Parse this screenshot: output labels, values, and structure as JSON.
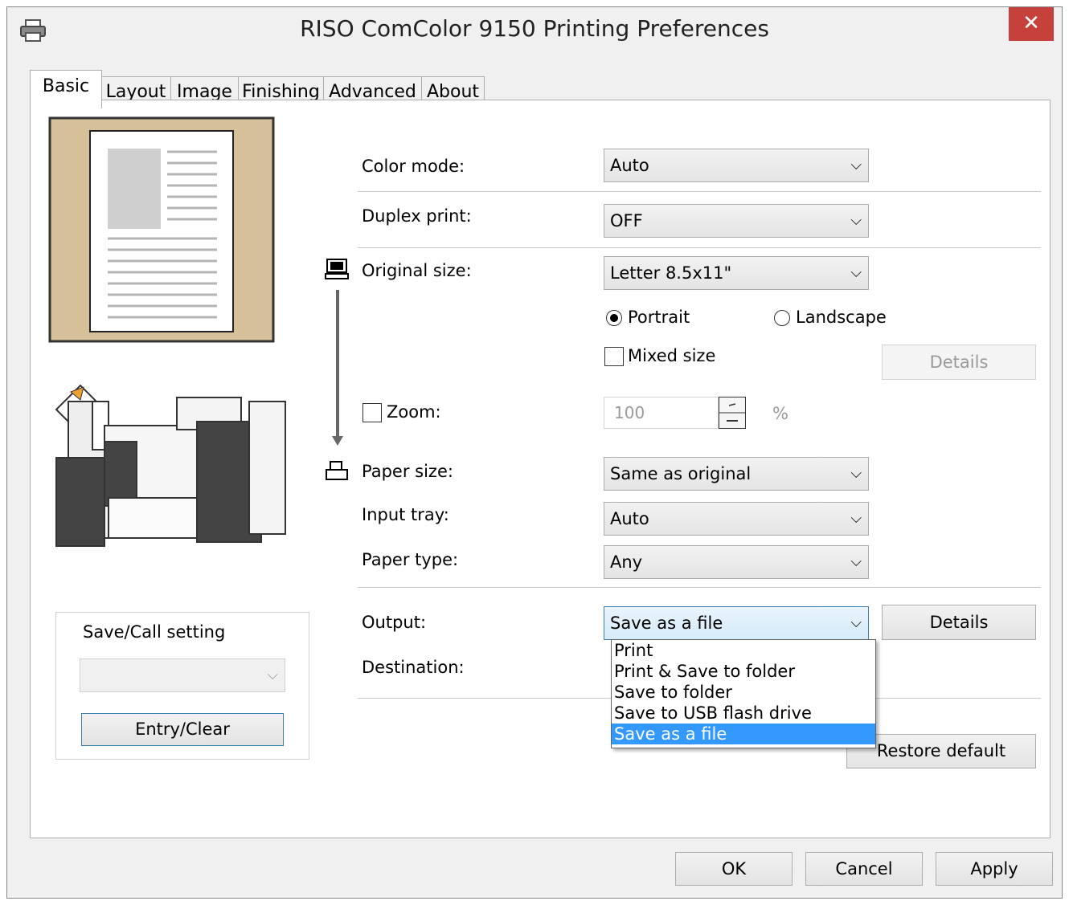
{
  "window": {
    "title": "RISO ComColor 9150 Printing Preferences",
    "close_glyph": "✕"
  },
  "tabs": [
    {
      "label": "Basic",
      "active": true
    },
    {
      "label": "Layout"
    },
    {
      "label": "Image"
    },
    {
      "label": "Finishing"
    },
    {
      "label": "Advanced"
    },
    {
      "label": "About"
    }
  ],
  "form": {
    "color_mode": {
      "label": "Color mode:",
      "value": "Auto"
    },
    "duplex": {
      "label": "Duplex print:",
      "value": "OFF"
    },
    "original_size": {
      "label": "Original size:",
      "value": "Letter 8.5x11\""
    },
    "orientation": {
      "portrait": "Portrait",
      "landscape": "Landscape",
      "selected": "Portrait"
    },
    "mixed_size": {
      "label": "Mixed size",
      "checked": false
    },
    "details_disabled": "Details",
    "zoom": {
      "label": "Zoom:",
      "value": "100",
      "unit": "%",
      "checked": false
    },
    "paper_size": {
      "label": "Paper size:",
      "value": "Same as original"
    },
    "input_tray": {
      "label": "Input tray:",
      "value": "Auto"
    },
    "paper_type": {
      "label": "Paper type:",
      "value": "Any"
    },
    "output": {
      "label": "Output:",
      "value": "Save as a file",
      "options": [
        "Print",
        "Print & Save to folder",
        "Save to folder",
        "Save to USB flash drive",
        "Save as a file"
      ],
      "selected_index": 4
    },
    "output_details": "Details",
    "destination": {
      "label": "Destination:"
    },
    "restore_default": "Restore default"
  },
  "save_call": {
    "title": "Save/Call setting",
    "entry_clear": "Entry/Clear"
  },
  "footer": {
    "ok": "OK",
    "cancel": "Cancel",
    "apply": "Apply"
  }
}
